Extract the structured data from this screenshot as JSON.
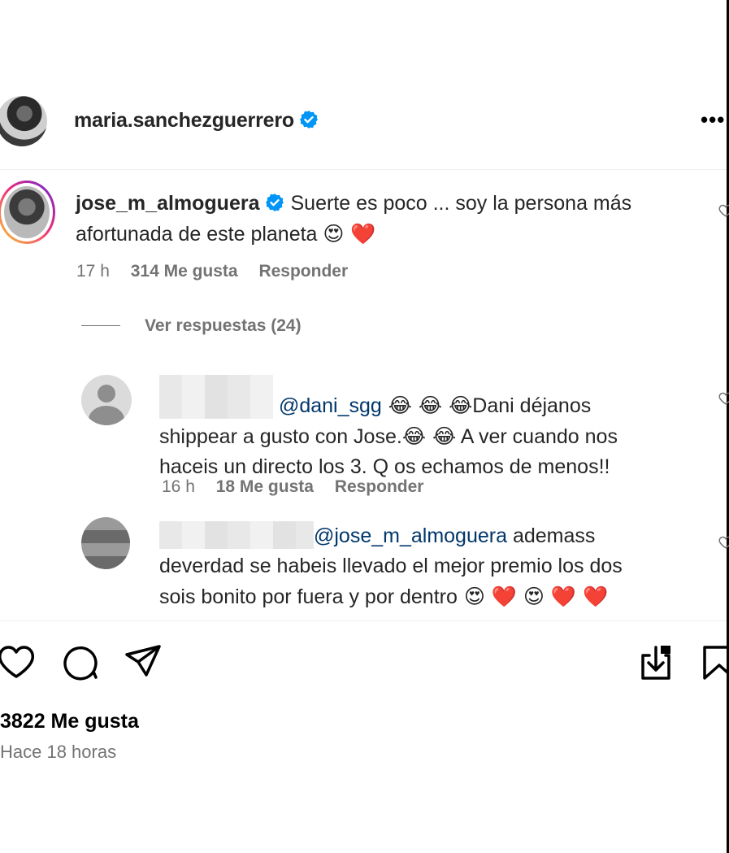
{
  "post": {
    "author": "maria.sanchezguerrero",
    "more_label": "•••"
  },
  "comment": {
    "username": "jose_m_almoguera",
    "text": "Suerte es poco ... soy la persona más afortunada de este planeta",
    "emojis": "😍 ❤️",
    "time": "17 h",
    "likes": "314 Me gusta",
    "reply": "Responder"
  },
  "view_replies": "Ver respuestas (24)",
  "replies": [
    {
      "mention": "@dani_sgg",
      "emojis_before": " 😂 😂 😂",
      "text_line1": "Dani déjanos",
      "text_line2": "shippear a gusto con Jose.",
      "emojis_mid": "😂 😂",
      "text_line2b": " A ver cuando nos",
      "text_line3": "haceis un directo los 3. Q os echamos de menos!!",
      "time": "16 h",
      "likes": "18 Me gusta",
      "reply": "Responder"
    },
    {
      "mention": "@jose_m_almoguera",
      "text_line1": " ademass",
      "text_line2": "deverdad se habeis llevado el mejor premio los dos",
      "text_line3": "sois bonito por fuera y por dentro",
      "emojis": " 😍 ❤️ 😍 ❤️ ❤️"
    }
  ],
  "likes_total": "3822 Me gusta",
  "posted_ago": "Hace 18 horas",
  "icons": {
    "verified": "verified-badge-icon",
    "like": "heart-icon",
    "comment": "comment-bubble-icon",
    "share": "paper-plane-icon",
    "save_download": "download-icon",
    "bookmark": "bookmark-icon"
  },
  "colors": {
    "verified_blue": "#0095f6",
    "mention": "#00376b",
    "muted_text": "#737373",
    "heart_red": "#ff3040"
  }
}
